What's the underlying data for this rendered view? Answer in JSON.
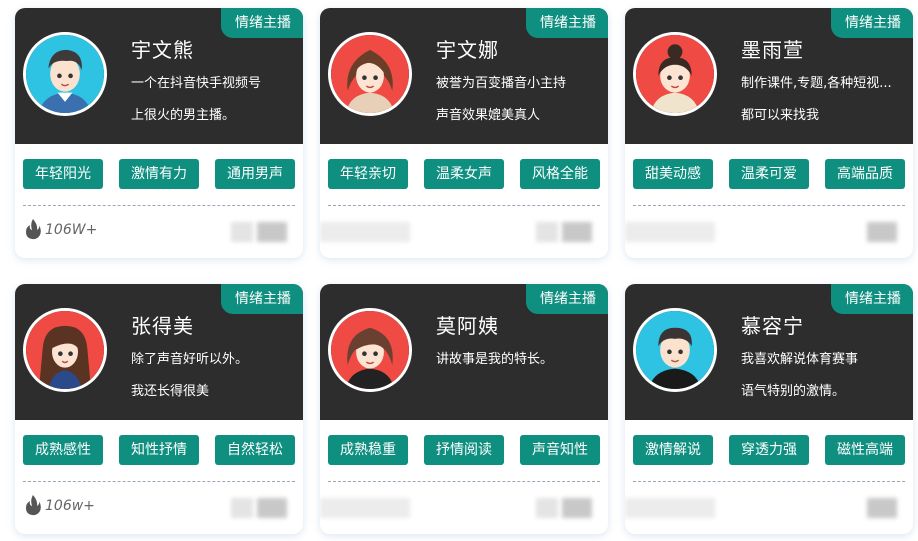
{
  "badge_label": "情绪主播",
  "colors": {
    "accent": "#0f8f80",
    "card_top": "#2d2d2d"
  },
  "cards": [
    {
      "name": "宇文熊",
      "desc1": "一个在抖音快手视频号",
      "desc2": "上很火的男主播。",
      "tags": [
        "年轻阳光",
        "激情有力",
        "通用男声"
      ],
      "plays": "106W+",
      "avatar_icon": "male-avatar-icon"
    },
    {
      "name": "宇文娜",
      "desc1": "被誉为百变播音小主持",
      "desc2": "声音效果媲美真人",
      "tags": [
        "年轻亲切",
        "温柔女声",
        "风格全能"
      ],
      "plays": "",
      "avatar_icon": "female-avatar-icon"
    },
    {
      "name": "墨雨萱",
      "desc1": "制作课件,专题,各种短视...",
      "desc2": "都可以来找我",
      "tags": [
        "甜美动感",
        "温柔可爱",
        "高端品质"
      ],
      "plays": "",
      "avatar_icon": "female-bun-avatar-icon"
    },
    {
      "name": "张得美",
      "desc1": "除了声音好听以外。",
      "desc2": "我还长得很美",
      "tags": [
        "成熟感性",
        "知性抒情",
        "自然轻松"
      ],
      "plays": "106w+",
      "avatar_icon": "female-longhair-avatar-icon"
    },
    {
      "name": "莫阿姨",
      "desc1": "讲故事是我的特长。",
      "desc2": "",
      "tags": [
        "成熟稳重",
        "抒情阅读",
        "声音知性"
      ],
      "plays": "",
      "avatar_icon": "female-mature-avatar-icon"
    },
    {
      "name": "慕容宁",
      "desc1": "我喜欢解说体育赛事",
      "desc2": "语气特别的激情。",
      "tags": [
        "激情解说",
        "穿透力强",
        "磁性高端"
      ],
      "plays": "",
      "avatar_icon": "male-sports-avatar-icon"
    }
  ]
}
